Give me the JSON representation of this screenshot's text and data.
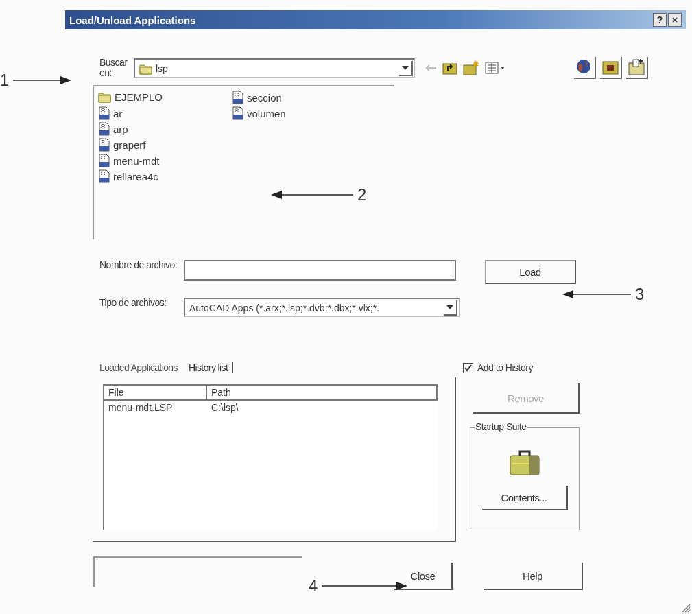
{
  "window": {
    "title": "Load/Unload Applications",
    "buttons": [
      "?",
      "×"
    ]
  },
  "look_in": {
    "label": "Buscar en:",
    "value": "lsp"
  },
  "files": [
    {
      "name": "EJEMPLO",
      "kind": "folder"
    },
    {
      "name": "ar",
      "kind": "lisp"
    },
    {
      "name": "arp",
      "kind": "lisp"
    },
    {
      "name": "graperf",
      "kind": "lisp"
    },
    {
      "name": "menu-mdt",
      "kind": "lisp"
    },
    {
      "name": "rellarea4c",
      "kind": "lisp"
    },
    {
      "name": "seccion",
      "kind": "lisp"
    },
    {
      "name": "volumen",
      "kind": "lisp"
    }
  ],
  "file_name": {
    "label": "Nombre de archivo:"
  },
  "load_button": "Load",
  "file_type": {
    "label": "Tipo de archivos:",
    "value": "AutoCAD Apps (*.arx;*.lsp;*.dvb;*.dbx;*.vlx;*."
  },
  "tabs": [
    {
      "label": "Loaded Applications",
      "selected": false
    },
    {
      "label": "History list",
      "selected": true
    }
  ],
  "table": {
    "columns": [
      "File",
      "Path"
    ],
    "rows": [
      [
        "menu-mdt.LSP",
        "C:\\lsp\\"
      ]
    ]
  },
  "add_to_history": {
    "label": "Add to History",
    "checked": true
  },
  "remove_button": {
    "label": "Remove",
    "disabled": true
  },
  "startup_suite": {
    "title": "Startup Suite",
    "button": "Contents..."
  },
  "buttons": [
    "Close",
    "Help"
  ],
  "annotations": [
    {
      "label": "1"
    },
    {
      "label": "2"
    },
    {
      "label": "3"
    },
    {
      "label": "4"
    }
  ]
}
